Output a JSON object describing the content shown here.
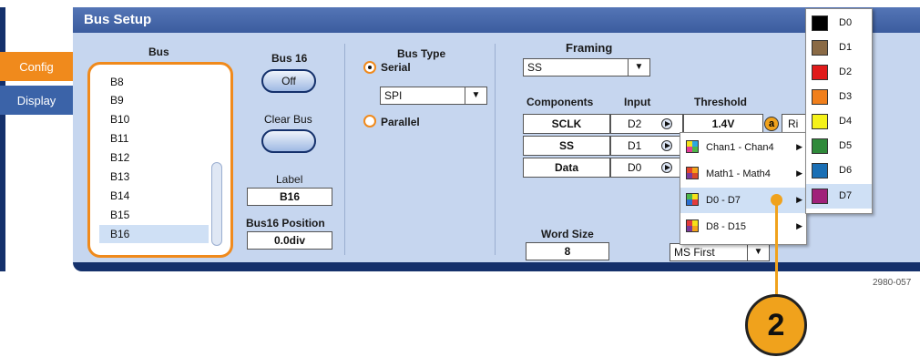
{
  "tabs": {
    "config": "Config",
    "display": "Display"
  },
  "title": "Bus Setup",
  "bus": {
    "header": "Bus",
    "items": [
      "B8",
      "B9",
      "B10",
      "B11",
      "B12",
      "B13",
      "B14",
      "B15",
      "B16"
    ],
    "selected": "B16"
  },
  "bus16": {
    "label": "Bus 16",
    "state": "Off"
  },
  "clear_bus": "Clear Bus",
  "label": {
    "header": "Label",
    "value": "B16"
  },
  "position": {
    "header": "Bus16 Position",
    "value": "0.0div"
  },
  "bus_type": {
    "header": "Bus Type",
    "serial": "Serial",
    "parallel": "Parallel",
    "protocol": "SPI"
  },
  "framing": {
    "header": "Framing",
    "value": "SS"
  },
  "components": {
    "headers": {
      "components": "Components",
      "input": "Input",
      "threshold": "Threshold"
    },
    "rows": [
      {
        "name": "SCLK",
        "input": "D2"
      },
      {
        "name": "SS",
        "input": "D1"
      },
      {
        "name": "Data",
        "input": "D0"
      }
    ],
    "threshold_value": "1.4V",
    "threshold_knob": "a",
    "edge_partial": "Ri"
  },
  "word_size": {
    "header": "Word Size",
    "value": "8"
  },
  "bit_order": "MS First",
  "source_menu": [
    {
      "label": "Chan1 - Chan4"
    },
    {
      "label": "Math1 - Math4"
    },
    {
      "label": "D0 - D7"
    },
    {
      "label": "D8 - D15"
    }
  ],
  "channel_menu": [
    {
      "label": "D0",
      "color": "#000000"
    },
    {
      "label": "D1",
      "color": "#8a6a45"
    },
    {
      "label": "D2",
      "color": "#e01a1a"
    },
    {
      "label": "D3",
      "color": "#f07f1c"
    },
    {
      "label": "D4",
      "color": "#f5f21a"
    },
    {
      "label": "D5",
      "color": "#2f8a3a"
    },
    {
      "label": "D6",
      "color": "#1a6fb5"
    },
    {
      "label": "D7",
      "color": "#a0217a"
    }
  ],
  "figure_ref": "2980-057",
  "callout": "2"
}
